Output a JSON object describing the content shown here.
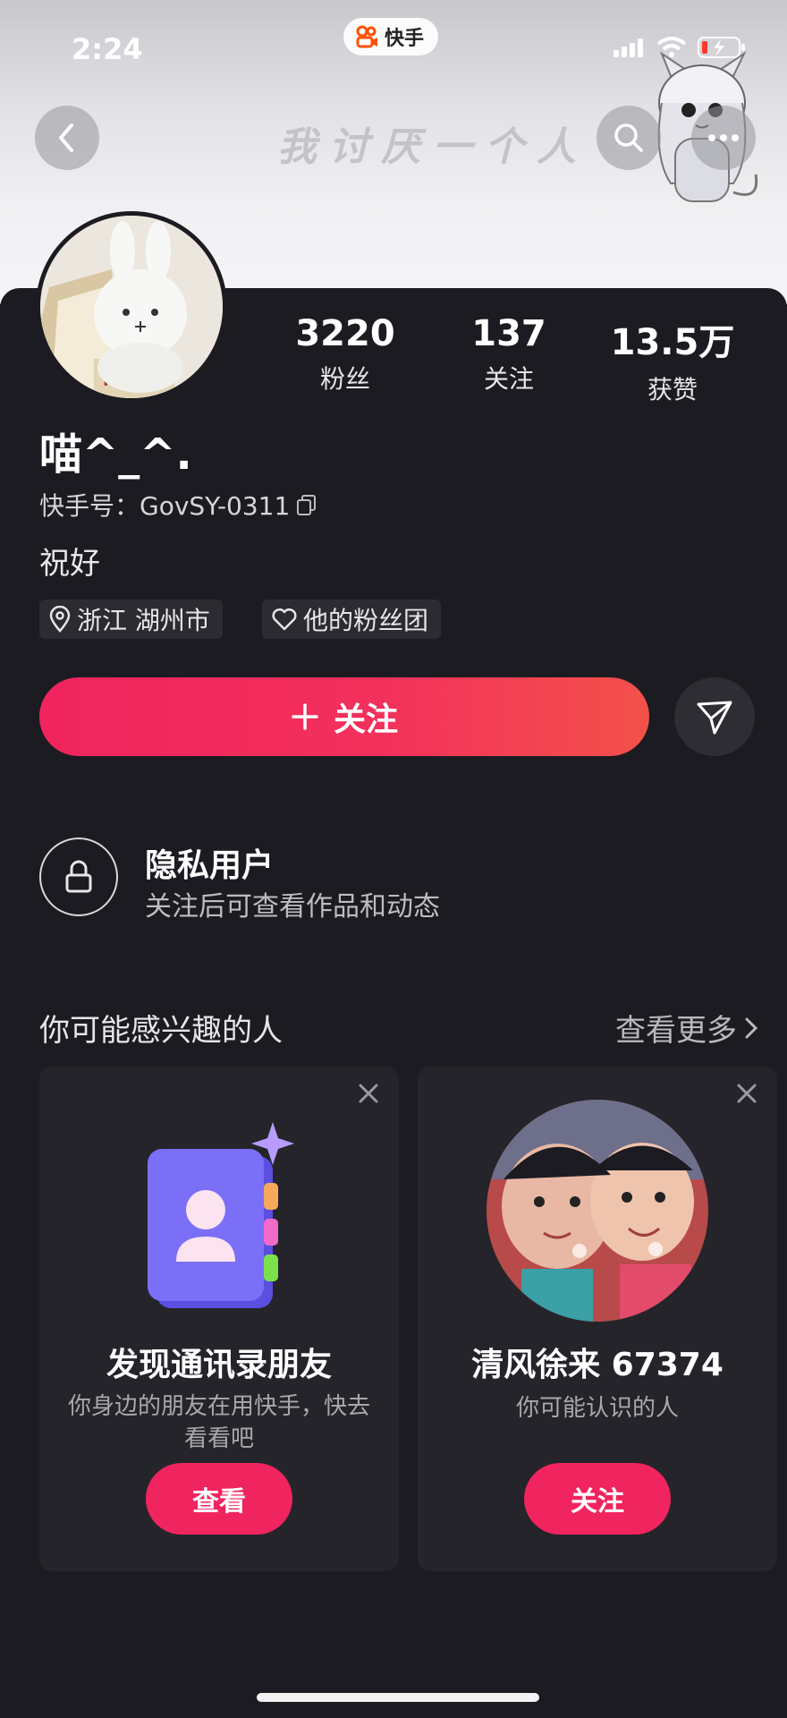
{
  "status_bar": {
    "time": "2:24",
    "app_name": "快手"
  },
  "banner": {
    "text": "我讨厌一个人",
    "icons": [
      "back-arrow-icon",
      "search-icon",
      "more-icon"
    ]
  },
  "profile": {
    "stats": [
      {
        "value": "3220",
        "label": "粉丝"
      },
      {
        "value": "137",
        "label": "关注"
      },
      {
        "value": "13.5万",
        "label": "获赞"
      }
    ],
    "username": "喵^_^.",
    "kuaishou_id": "快手号：GovSY-0311",
    "bio": "祝好",
    "tags": [
      {
        "icon": "location-pin-icon",
        "label": "浙江 湖州市"
      },
      {
        "icon": "heart-outline-icon",
        "label": "他的粉丝团"
      }
    ],
    "follow_label": "关注"
  },
  "privacy": {
    "title": "隐私用户",
    "subtitle": "关注后可查看作品和动态"
  },
  "suggestions": {
    "title": "你可能感兴趣的人",
    "see_more": "查看更多",
    "cards": [
      {
        "title": "发现通讯录朋友",
        "subtitle": "你身边的朋友在用快手，快去看看吧",
        "button": "查看"
      },
      {
        "title": "清风徐来 67374",
        "subtitle": "你可能认识的人",
        "button": "关注"
      }
    ]
  },
  "colors": {
    "accent": "#f0245e",
    "background": "#1c1b21",
    "card": "#25242b"
  }
}
